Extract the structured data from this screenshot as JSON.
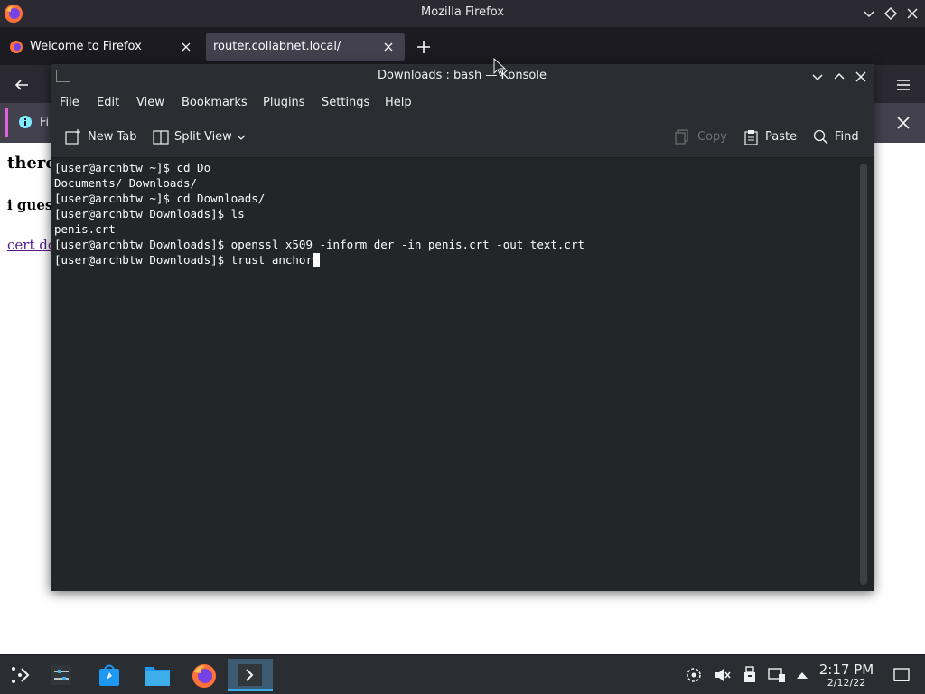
{
  "firefox": {
    "title": "Mozilla Firefox",
    "tabs": [
      {
        "label": "Welcome to Firefox"
      },
      {
        "label": "router.collabnet.local/"
      }
    ],
    "notification_text": "Fi",
    "content": {
      "heading": "there",
      "subheading": "i guess",
      "link": "cert do"
    }
  },
  "konsole": {
    "title": "Downloads : bash — Konsole",
    "menu": [
      "File",
      "Edit",
      "View",
      "Bookmarks",
      "Plugins",
      "Settings",
      "Help"
    ],
    "toolbar": {
      "new_tab": "New Tab",
      "split_view": "Split View",
      "copy": "Copy",
      "paste": "Paste",
      "find": "Find"
    },
    "terminal_lines": [
      "[user@archbtw ~]$ cd Do",
      "Documents/ Downloads/",
      "[user@archbtw ~]$ cd Downloads/",
      "[user@archbtw Downloads]$ ls",
      "penis.crt",
      "[user@archbtw Downloads]$ openssl x509 -inform der -in penis.crt -out text.crt",
      "[user@archbtw Downloads]$ trust anchor"
    ]
  },
  "taskbar": {
    "clock_time": "2:17 PM",
    "clock_date": "2/12/22"
  },
  "icons": {
    "firefox": "firefox-icon",
    "konsole": "konsole-icon",
    "files": "folder-icon",
    "store": "discover-icon",
    "settings": "system-settings-icon",
    "launcher": "app-launcher-icon"
  },
  "colors": {
    "accent": "#3daee9",
    "terminal_bg": "#232629",
    "link": "#551a8b"
  }
}
